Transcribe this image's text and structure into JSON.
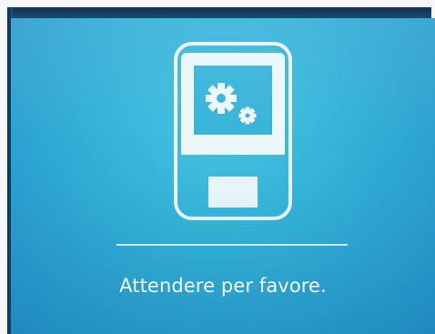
{
  "screen": {
    "status_text": "Attendere per favore.",
    "icon": "device-settings-icon",
    "colors": {
      "background": "#33b2d8",
      "foreground": "#f2fbfe"
    }
  }
}
